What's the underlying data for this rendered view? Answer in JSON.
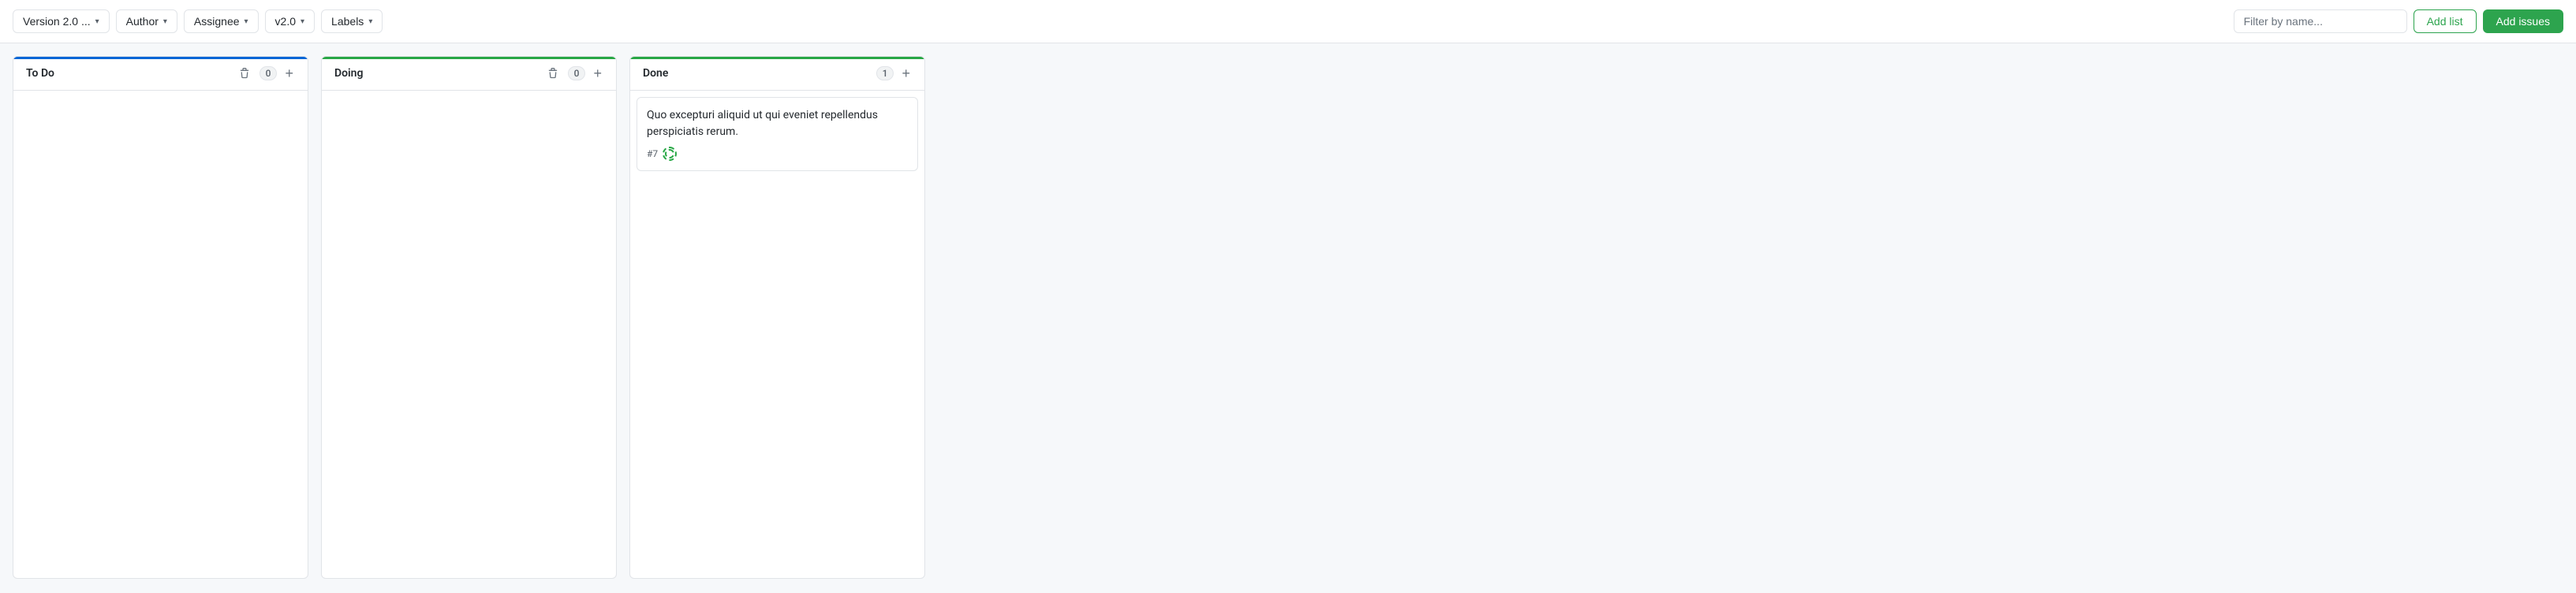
{
  "toolbar": {
    "version_label": "Version 2.0 ...",
    "author_label": "Author",
    "assignee_label": "Assignee",
    "version_filter_label": "v2.0",
    "labels_label": "Labels",
    "filter_placeholder": "Filter by name...",
    "add_list_label": "Add list",
    "add_issues_label": "Add issues"
  },
  "board": {
    "columns": [
      {
        "id": "todo",
        "title": "To Do",
        "count": 0,
        "color": "blue",
        "issues": []
      },
      {
        "id": "doing",
        "title": "Doing",
        "count": 0,
        "color": "green",
        "issues": []
      },
      {
        "id": "done",
        "title": "Done",
        "count": 1,
        "color": "green",
        "issues": [
          {
            "number": "#7",
            "title": "Quo excepturi aliquid ut qui eveniet repellendus perspiciatis rerum."
          }
        ]
      }
    ]
  }
}
